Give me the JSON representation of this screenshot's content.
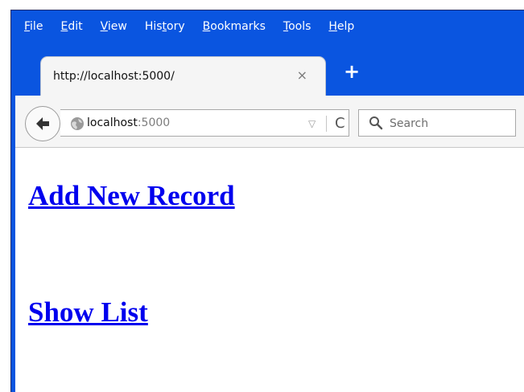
{
  "browser": {
    "menu": [
      {
        "lead": "F",
        "rest": "ile"
      },
      {
        "lead": "E",
        "rest": "dit"
      },
      {
        "lead": "V",
        "rest": "iew"
      },
      {
        "lead": "His",
        "mid": "t",
        "rest": "ory"
      },
      {
        "lead": "B",
        "rest": "ookmarks"
      },
      {
        "lead": "T",
        "rest": "ools"
      },
      {
        "lead": "H",
        "rest": "elp"
      }
    ],
    "tab": {
      "title": "http://localhost:5000/",
      "close_glyph": "×"
    },
    "new_tab_glyph": "+",
    "url": {
      "host": "localhost",
      "port": ":5000"
    },
    "dropdown_glyph": "▽",
    "reload_glyph": "C",
    "search": {
      "placeholder": "Search"
    },
    "colors": {
      "chrome": "#0a55e0",
      "link": "#0000ee"
    }
  },
  "page": {
    "links": [
      {
        "label": "Add New Record"
      },
      {
        "label": "Show List"
      }
    ]
  }
}
